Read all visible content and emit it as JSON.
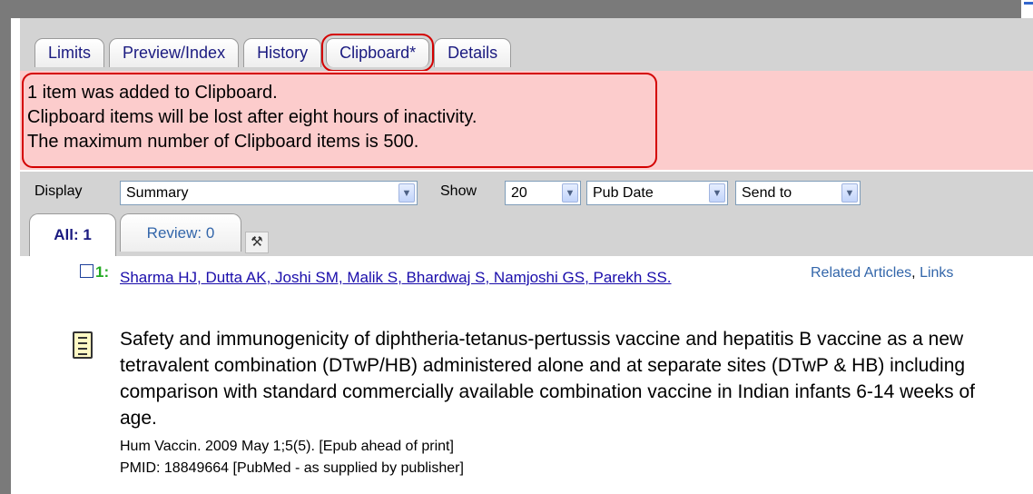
{
  "tabs": [
    "Limits",
    "Preview/Index",
    "History",
    "Clipboard*",
    "Details"
  ],
  "alert": {
    "lines": [
      "1 item was added to Clipboard.",
      "Clipboard items will be lost after eight hours of inactivity.",
      "The maximum number of Clipboard items is 500."
    ],
    "color": "#fccccc"
  },
  "toolbar": {
    "display_label": "Display",
    "display_value": "Summary",
    "show_label": "Show",
    "show_value": "20",
    "sort_value": "Pub Date",
    "send_value": "Send to"
  },
  "subtabs": {
    "all": "All: 1",
    "review": "Review: 0"
  },
  "result": {
    "number": "1:",
    "authors": "Sharma HJ, Dutta AK, Joshi SM, Malik S, Bhardwaj S, Namjoshi GS, Parekh SS.",
    "related": "Related Articles",
    "links": "Links",
    "title": "Safety and immunogenicity of diphtheria-tetanus-pertussis vaccine and hepatitis B vaccine as a new tetravalent combination (DTwP/HB) administered alone and at separate sites (DTwP & HB) including comparison with standard commercially available combination vaccine in Indian infants 6-14 weeks of age.",
    "citation": "Hum Vaccin. 2009 May 1;5(5). [Epub ahead of print]",
    "pmid": "PMID: 18849664 [PubMed - as supplied by publisher]"
  },
  "icons": {
    "tools": "tools-icon",
    "document": "document-icon",
    "dropdown": "chevron-down-icon"
  }
}
